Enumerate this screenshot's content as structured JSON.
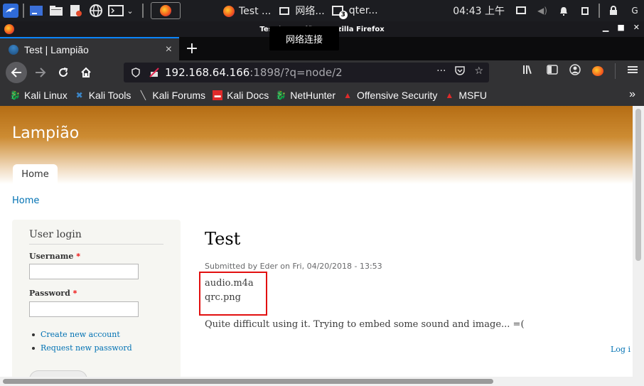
{
  "taskbar": {
    "tasks": [
      {
        "label": "Test ..."
      },
      {
        "label": "网络..."
      },
      {
        "label": "qter..."
      }
    ],
    "terminal_badge": "3",
    "clock": "04:43 上午"
  },
  "window": {
    "title": "Test | Lampião - Mozilla Firefox",
    "tooltip": "网络连接"
  },
  "tab": {
    "label": "Test | Lampião",
    "close_glyph": "×",
    "new_tab_glyph": "+"
  },
  "url": {
    "host": "192.168.64.166",
    "rest": ":1898/?q=node/2",
    "more_glyph": "···"
  },
  "bookmarks": [
    {
      "label": "Kali Linux",
      "icon": "kali-dragon-icon",
      "color": "#e8543c"
    },
    {
      "label": "Kali Tools",
      "icon": "kali-tools-icon",
      "color": "#3b86c8"
    },
    {
      "label": "Kali Forums",
      "icon": "kali-forums-icon",
      "color": "#cfcfcf"
    },
    {
      "label": "Kali Docs",
      "icon": "kali-docs-icon",
      "color": "#e02a2a"
    },
    {
      "label": "NetHunter",
      "icon": "nethunter-icon",
      "color": "#e8543c"
    },
    {
      "label": "Offensive Security",
      "icon": "offsec-icon",
      "color": "#e02a2a"
    },
    {
      "label": "MSFU",
      "icon": "msfu-icon",
      "color": "#e02a2a"
    }
  ],
  "bookmarks_more": "»",
  "site": {
    "name": "Lampião",
    "primary_tab": "Home",
    "breadcrumb": "Home",
    "accent": "#0071b3"
  },
  "login": {
    "title": "User login",
    "username_label": "Username",
    "password_label": "Password",
    "required_mark": "*",
    "links": [
      "Create new account",
      "Request new password"
    ],
    "block_link": "Log i"
  },
  "node": {
    "title": "Test",
    "submitted": "Submitted by Eder on Fri, 04/20/2018 - 13:53",
    "line1": "audio.m4a",
    "line2": "qrc.png",
    "paragraph": "Quite difficult using it. Trying to embed some sound and image... =("
  }
}
